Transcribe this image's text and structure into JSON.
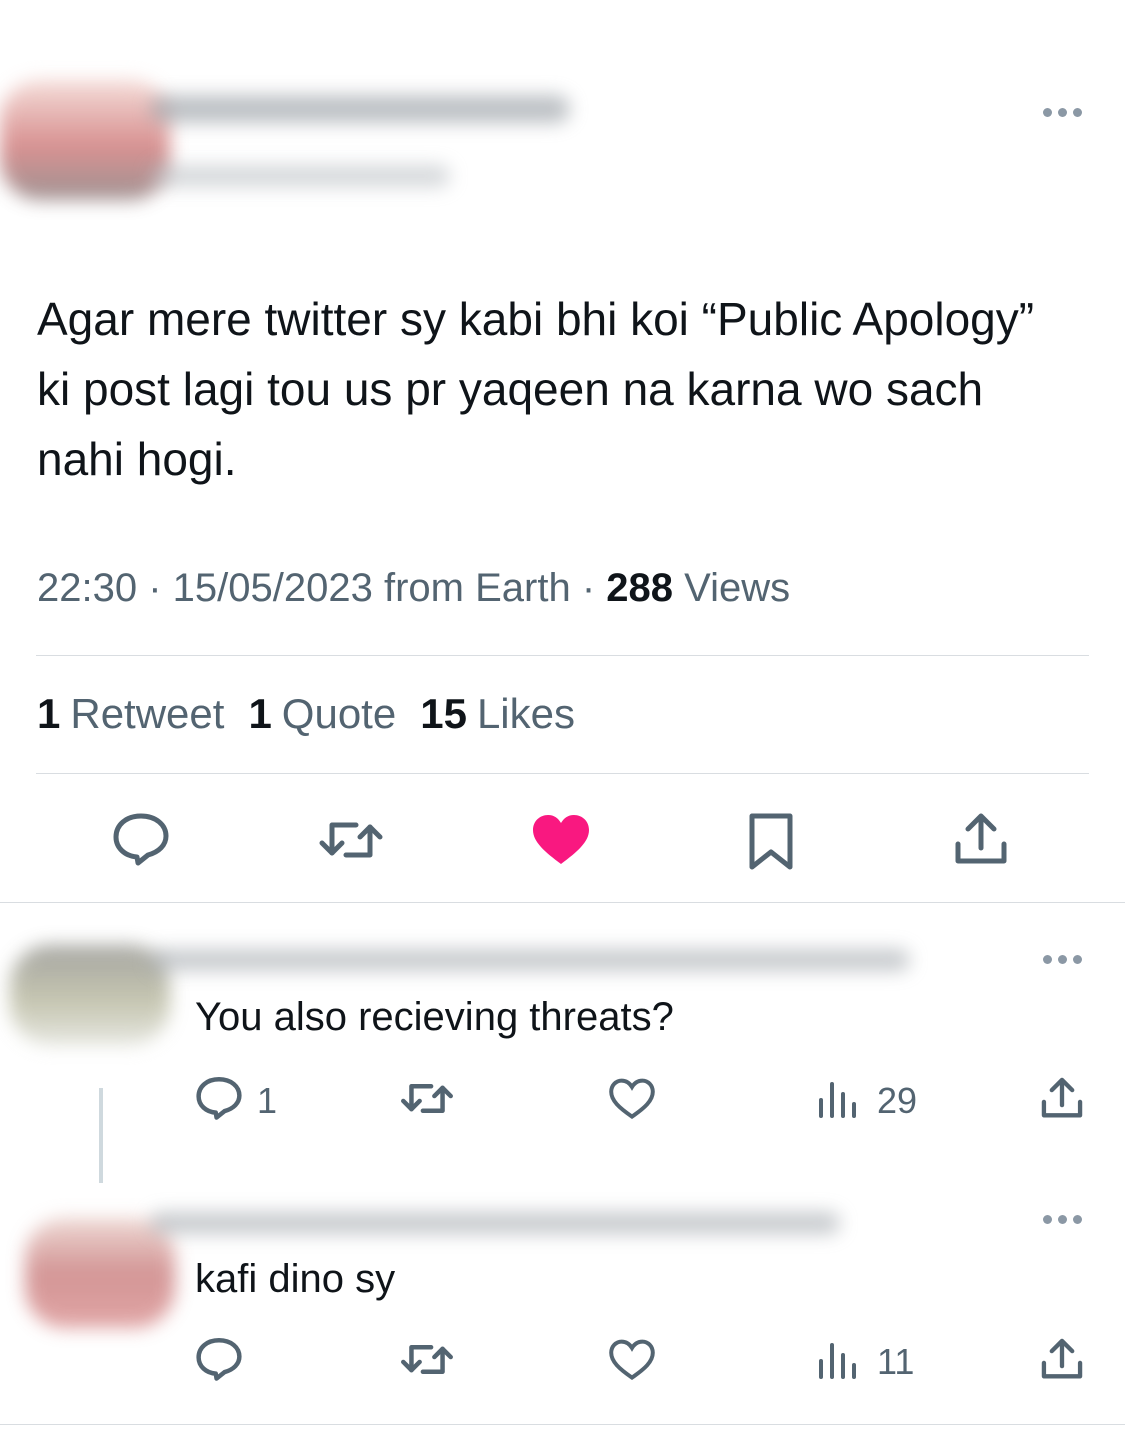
{
  "tweet": {
    "text": "Agar mere twitter sy kabi bhi koi “Public Apology” ki post lagi tou us pr yaqeen na karna wo sach nahi hogi.",
    "time": "22:30",
    "sep1": " · ",
    "date": "15/05/2023",
    "from": " from Earth",
    "sep2": " · ",
    "views_count": "288",
    "views_label": " Views",
    "retweets_count": "1",
    "retweets_label": "Retweet",
    "quotes_count": "1",
    "quotes_label": "Quote",
    "likes_count": "15",
    "likes_label": "Likes",
    "liked": true,
    "like_color": "#f91880"
  },
  "replies": [
    {
      "text": "You also recieving threats?",
      "reply_count": "1",
      "views": "29"
    },
    {
      "text": "kafi dino sy",
      "reply_count": "",
      "views": "11"
    }
  ],
  "icons": {
    "more": "more-horizontal-icon",
    "reply": "reply-icon",
    "retweet": "retweet-icon",
    "like": "heart-icon",
    "bookmark": "bookmark-icon",
    "share": "share-icon",
    "views": "views-chart-icon"
  },
  "colors": {
    "text": "#0f1419",
    "secondary": "#536471",
    "divider": "#d9dde1"
  }
}
